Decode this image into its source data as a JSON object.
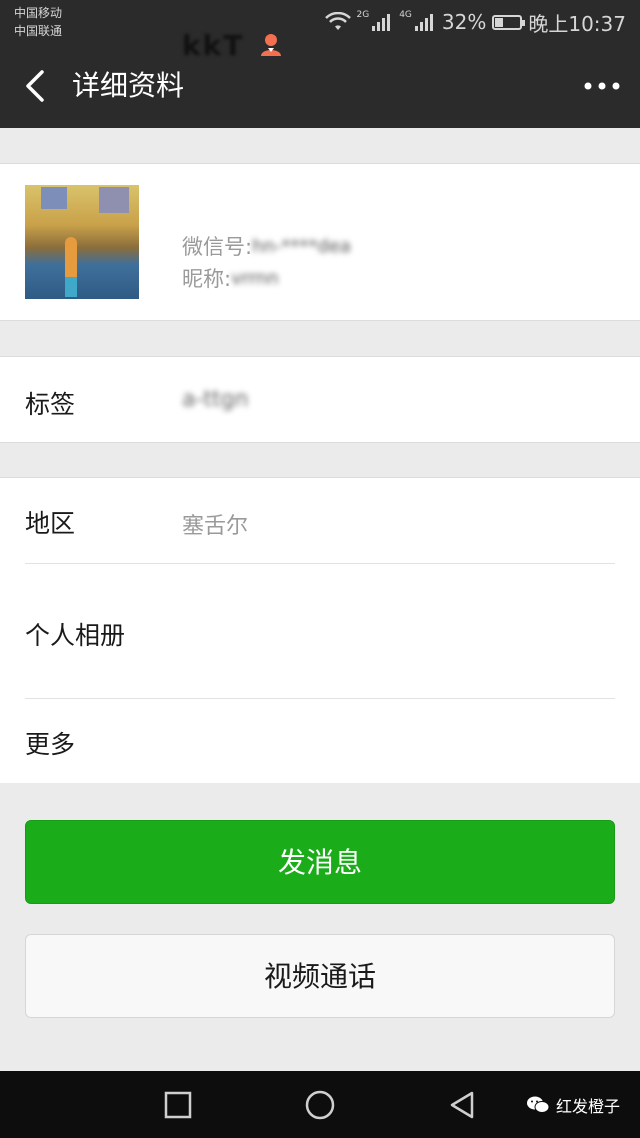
{
  "status_bar": {
    "carrier1": "中国移动",
    "carrier2": "中国联通",
    "net_2g": "2G",
    "net_4g": "4G",
    "battery": "32%",
    "time": "晚上10:37"
  },
  "title_bar": {
    "title": "详细资料"
  },
  "profile": {
    "name": "kkT",
    "wechat_label": "微信号:",
    "wechat_value": "hn-****dea",
    "nickname_label": "昵称:",
    "nickname_value": "vrrnn"
  },
  "tags": {
    "label": "标签",
    "value": "a-ttgn"
  },
  "info": {
    "region_label": "地区",
    "region_value": "塞舌尔",
    "album_label": "个人相册",
    "more_label": "更多"
  },
  "actions": {
    "send_message": "发消息",
    "video_call": "视频通话"
  },
  "watermark": {
    "text": "红发橙子"
  },
  "colors": {
    "header_bg": "#2b2b2b",
    "primary_green": "#1aad19",
    "gender_female": "#f26f4f"
  }
}
